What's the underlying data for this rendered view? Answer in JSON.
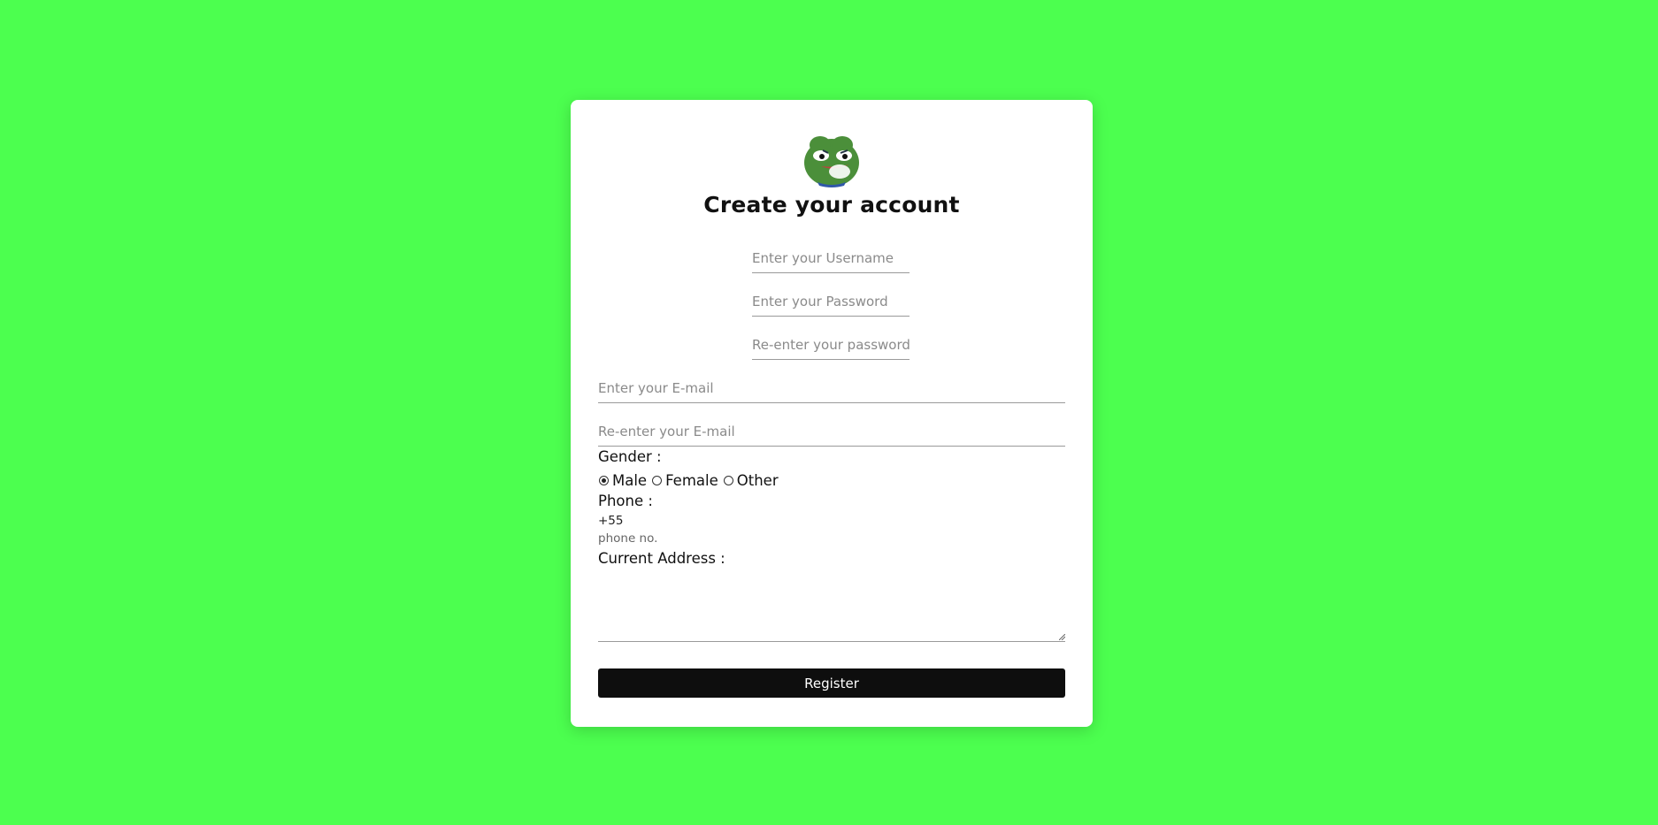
{
  "page": {
    "background_color": "#4cff4f"
  },
  "form": {
    "avatar_icon": "frog-avatar-icon",
    "title": "Create your account",
    "username_placeholder": "Enter your Username",
    "password_placeholder": "Enter your Password",
    "repassword_placeholder": "Re-enter your password",
    "email_placeholder": "Enter your E-mail",
    "reemail_placeholder": "Re-enter your E-mail",
    "gender_label": "Gender :",
    "gender_options": [
      {
        "label": "Male",
        "checked": true
      },
      {
        "label": "Female",
        "checked": false
      },
      {
        "label": "Other",
        "checked": false
      }
    ],
    "phone_label": "Phone :",
    "phone_code": "+55",
    "phone_placeholder": "phone no.",
    "address_label": "Current Address :",
    "register_label": "Register",
    "button_color": "#0e0e0e"
  }
}
